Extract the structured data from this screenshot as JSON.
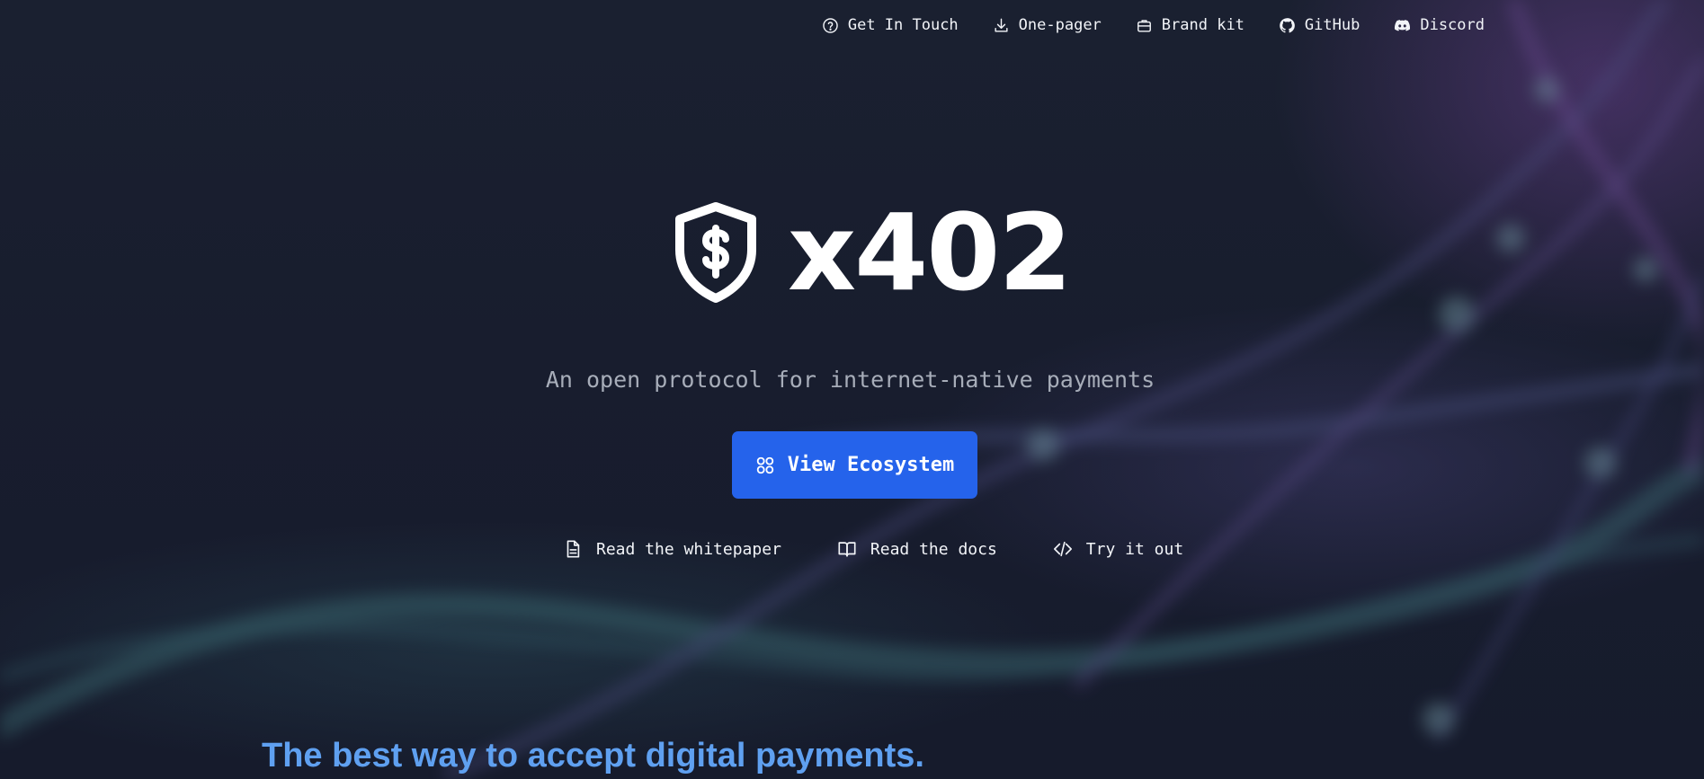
{
  "nav": {
    "items": [
      {
        "label": "Get In Touch",
        "icon": "help-circle-icon"
      },
      {
        "label": "One-pager",
        "icon": "download-icon"
      },
      {
        "label": "Brand kit",
        "icon": "briefcase-icon"
      },
      {
        "label": "GitHub",
        "icon": "github-icon"
      },
      {
        "label": "Discord",
        "icon": "discord-icon"
      }
    ]
  },
  "hero": {
    "logo_text": "x402",
    "logo_icon": "shield-dollar-icon",
    "tagline": "An open protocol for internet-native payments",
    "cta": {
      "label": "View Ecosystem",
      "icon": "grid-icon"
    },
    "links": [
      {
        "label": "Read the whitepaper",
        "icon": "document-icon"
      },
      {
        "label": "Read the docs",
        "icon": "book-open-icon"
      },
      {
        "label": "Try it out",
        "icon": "code-icon"
      }
    ]
  },
  "section": {
    "heading": "The best way to accept digital payments."
  },
  "colors": {
    "background": "#151a2b",
    "accent": "#2563eb",
    "heading": "#5fa0f0",
    "tagline": "#a7adb9"
  }
}
